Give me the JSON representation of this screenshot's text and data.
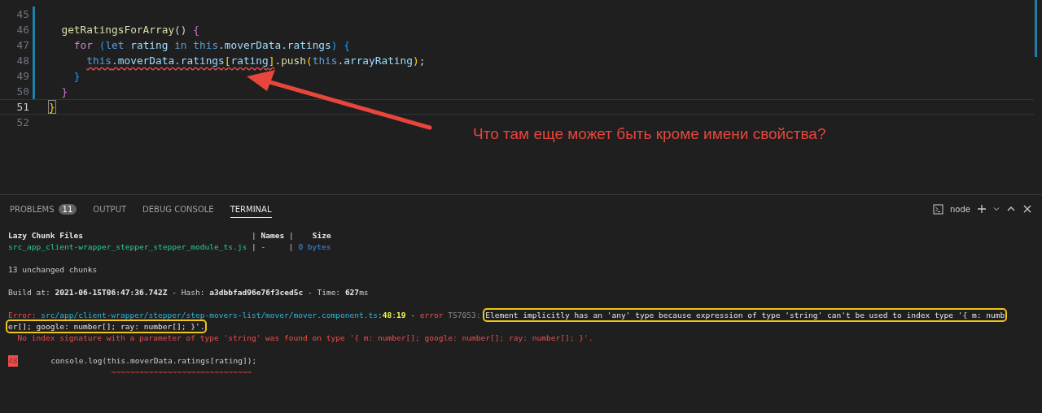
{
  "editor": {
    "lines": [
      {
        "number": "45",
        "current": false
      },
      {
        "number": "46",
        "current": false,
        "tokens": [
          {
            "text": "  getRatingsForArray",
            "kind": "function"
          },
          {
            "text": "() ",
            "kind": "punct"
          },
          {
            "text": "{",
            "kind": "bracket2"
          }
        ]
      },
      {
        "number": "47",
        "current": false,
        "tokens": [
          {
            "text": "    for ",
            "kind": "keyword"
          },
          {
            "text": "(",
            "kind": "bracket3"
          },
          {
            "text": "let",
            "kind": "storage"
          },
          {
            "text": " rating ",
            "kind": "variable"
          },
          {
            "text": "in this",
            "kind": "storage"
          },
          {
            "text": ".moverData.ratings",
            "kind": "variable"
          },
          {
            "text": ")",
            "kind": "bracket3"
          },
          {
            "text": " {",
            "kind": "bracket3"
          }
        ]
      },
      {
        "number": "48",
        "current": false,
        "tokens": [
          {
            "text": "      this",
            "kind": "storage",
            "squiggle": true
          },
          {
            "text": ".moverData.ratings",
            "kind": "variable",
            "squiggle": true
          },
          {
            "text": "[",
            "kind": "bracket1",
            "squiggle": true
          },
          {
            "text": "rating",
            "kind": "variable",
            "squiggle": true
          },
          {
            "text": "]",
            "kind": "bracket1",
            "squiggle": true
          },
          {
            "text": ".",
            "kind": "punct"
          },
          {
            "text": "push",
            "kind": "function"
          },
          {
            "text": "(",
            "kind": "bracket1"
          },
          {
            "text": "this",
            "kind": "storage"
          },
          {
            "text": ".arrayRating",
            "kind": "variable"
          },
          {
            "text": ")",
            "kind": "bracket1"
          },
          {
            "text": ";",
            "kind": "punct"
          }
        ]
      },
      {
        "number": "49",
        "current": false,
        "tokens": [
          {
            "text": "    }",
            "kind": "bracket3"
          }
        ]
      },
      {
        "number": "50",
        "current": false,
        "tokens": [
          {
            "text": "  }",
            "kind": "bracket2"
          }
        ]
      },
      {
        "number": "51",
        "current": true,
        "tokens": [
          {
            "text": "}",
            "kind": "bracket1",
            "matched": true
          }
        ]
      },
      {
        "number": "52",
        "current": false
      }
    ],
    "annotation": {
      "text": "Что там еще может быть кроме имени свойства?"
    }
  },
  "panel": {
    "tabs": [
      {
        "label": "PROBLEMS",
        "badge": "11",
        "selected": false
      },
      {
        "label": "OUTPUT",
        "selected": false
      },
      {
        "label": "DEBUG CONSOLE",
        "selected": false
      },
      {
        "label": "TERMINAL",
        "selected": true
      }
    ],
    "terminal_name": "node",
    "blocks": [
      {
        "lines": [
          {
            "segments": [
              {
                "text": "Lazy Chunk Files                                    ",
                "kind": "bold"
              },
              {
                "text": "| ",
                "kind": "plain"
              },
              {
                "text": "Names",
                "kind": "bold"
              },
              {
                "text": " |    ",
                "kind": "plain"
              },
              {
                "text": "Size",
                "kind": "bold"
              }
            ]
          },
          {
            "segments": [
              {
                "text": "src_app_client-wrapper_stepper_stepper_module_ts.js",
                "kind": "green"
              },
              {
                "text": " | -     | ",
                "kind": "plain"
              },
              {
                "text": "0 bytes",
                "kind": "blue"
              }
            ]
          }
        ]
      },
      {
        "lines": [
          {
            "segments": [
              {
                "text": "13 unchanged chunks",
                "kind": "plain"
              }
            ]
          }
        ]
      },
      {
        "lines": [
          {
            "segments": [
              {
                "text": "Build at: ",
                "kind": "plain"
              },
              {
                "text": "2021-06-15T06:47:36.742Z",
                "kind": "bold"
              },
              {
                "text": " - Hash: ",
                "kind": "plain"
              },
              {
                "text": "a3dbbfad96e76f3ced5c",
                "kind": "bold"
              },
              {
                "text": " - Time: ",
                "kind": "plain"
              },
              {
                "text": "627",
                "kind": "bold"
              },
              {
                "text": "ms",
                "kind": "plain"
              }
            ]
          }
        ]
      },
      {
        "lines": [
          {
            "segments": [
              {
                "text": "Error: ",
                "kind": "red"
              },
              {
                "text": "src/app/client-wrapper/stepper/step-movers-list/mover/mover.component.ts",
                "kind": "cyan"
              },
              {
                "text": ":",
                "kind": "plain"
              },
              {
                "text": "48",
                "kind": "yellow"
              },
              {
                "text": ":",
                "kind": "plain"
              },
              {
                "text": "19",
                "kind": "yellow"
              },
              {
                "text": " - ",
                "kind": "plain"
              },
              {
                "text": "error",
                "kind": "red"
              },
              {
                "text": " TS7053: ",
                "kind": "grey"
              },
              {
                "text": "Element implicitly has an 'any' type because expression of type 'string' can't be used to index type '{ m: numb",
                "kind": "highlight"
              }
            ]
          },
          {
            "segments": [
              {
                "text": "er[]; google: number[]; ray: number[]; }'.",
                "kind": "highlight"
              }
            ]
          },
          {
            "segments": [
              {
                "text": "  No index signature with a parameter of type 'string' was found on type '{ m: number[]; google: number[]; ray: number[]; }'.",
                "kind": "red"
              }
            ]
          }
        ]
      },
      {
        "lines": [
          {
            "segments": [
              {
                "text": "48",
                "kind": "gutter"
              },
              {
                "text": "       console.log(this.moverData.ratings[rating]);",
                "kind": "plain"
              }
            ]
          },
          {
            "segments": [
              {
                "text": "                      ~~~~~~~~~~~~~~~~~~~~~~~~~~~~~~",
                "kind": "red"
              }
            ]
          }
        ]
      }
    ]
  }
}
